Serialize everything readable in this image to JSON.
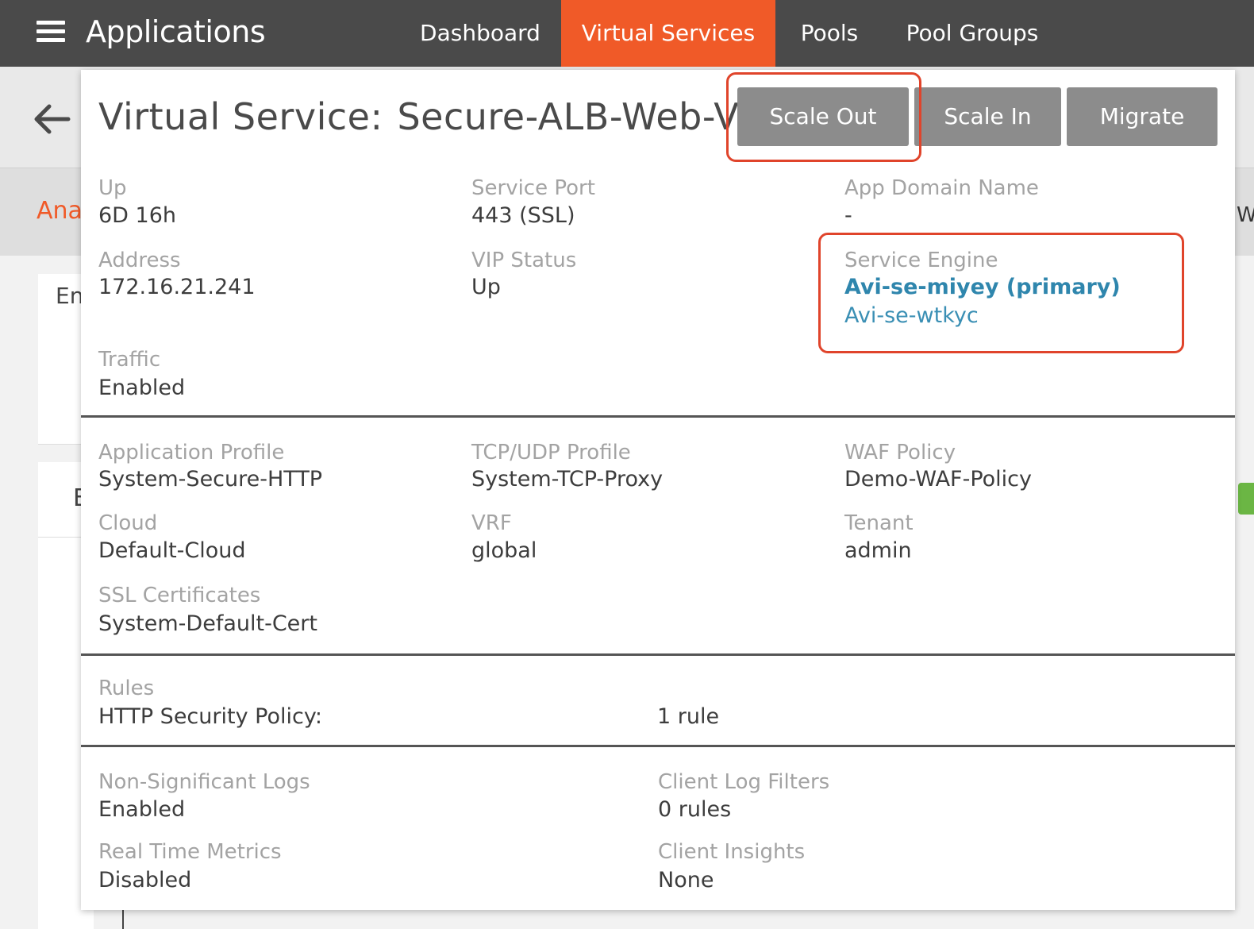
{
  "nav": {
    "app_title": "Applications",
    "tabs": [
      "Dashboard",
      "Virtual Services",
      "Pools",
      "Pool Groups"
    ],
    "active_tab": "Virtual Services",
    "accent_color": "#f05a28"
  },
  "background": {
    "subtab_partial": "Ana",
    "card_title_partial": "En",
    "card2_title_partial": "E",
    "right_partial": "W"
  },
  "modal": {
    "title_prefix": "Virtual Service:",
    "title_name": "Secure-ALB-Web-VS",
    "buttons": {
      "scale_out": "Scale Out",
      "scale_in": "Scale In",
      "migrate": "Migrate"
    },
    "summary": {
      "up": {
        "label": "Up",
        "value": "6D 16h"
      },
      "service_port": {
        "label": "Service Port",
        "value": "443 (SSL)"
      },
      "app_domain_name": {
        "label": "App Domain Name",
        "value": "-"
      },
      "address": {
        "label": "Address",
        "value": "172.16.21.241"
      },
      "vip_status": {
        "label": "VIP Status",
        "value": "Up"
      },
      "service_engine": {
        "label": "Service Engine",
        "primary": "Avi-se-miyey (primary)",
        "secondary": "Avi-se-wtkyc"
      },
      "traffic": {
        "label": "Traffic",
        "value": "Enabled"
      }
    },
    "profiles": {
      "application_profile": {
        "label": "Application Profile",
        "value": "System-Secure-HTTP"
      },
      "tcp_udp_profile": {
        "label": "TCP/UDP Profile",
        "value": "System-TCP-Proxy"
      },
      "waf_policy": {
        "label": "WAF Policy",
        "value": "Demo-WAF-Policy"
      },
      "cloud": {
        "label": "Cloud",
        "value": "Default-Cloud"
      },
      "vrf": {
        "label": "VRF",
        "value": "global"
      },
      "tenant": {
        "label": "Tenant",
        "value": "admin"
      },
      "ssl_certificates": {
        "label": "SSL Certificates",
        "value": "System-Default-Cert"
      }
    },
    "rules": {
      "label": "Rules",
      "items": [
        {
          "name": "HTTP Security Policy:",
          "count": "1 rule"
        }
      ]
    },
    "logging": {
      "non_significant_logs": {
        "label": "Non-Significant Logs",
        "value": "Enabled"
      },
      "client_log_filters": {
        "label": "Client Log Filters",
        "value": "0 rules"
      },
      "real_time_metrics": {
        "label": "Real Time Metrics",
        "value": "Disabled"
      },
      "client_insights": {
        "label": "Client Insights",
        "value": "None"
      }
    },
    "highlight_color": "#e0442b",
    "link_color": "#3a8fb4"
  }
}
